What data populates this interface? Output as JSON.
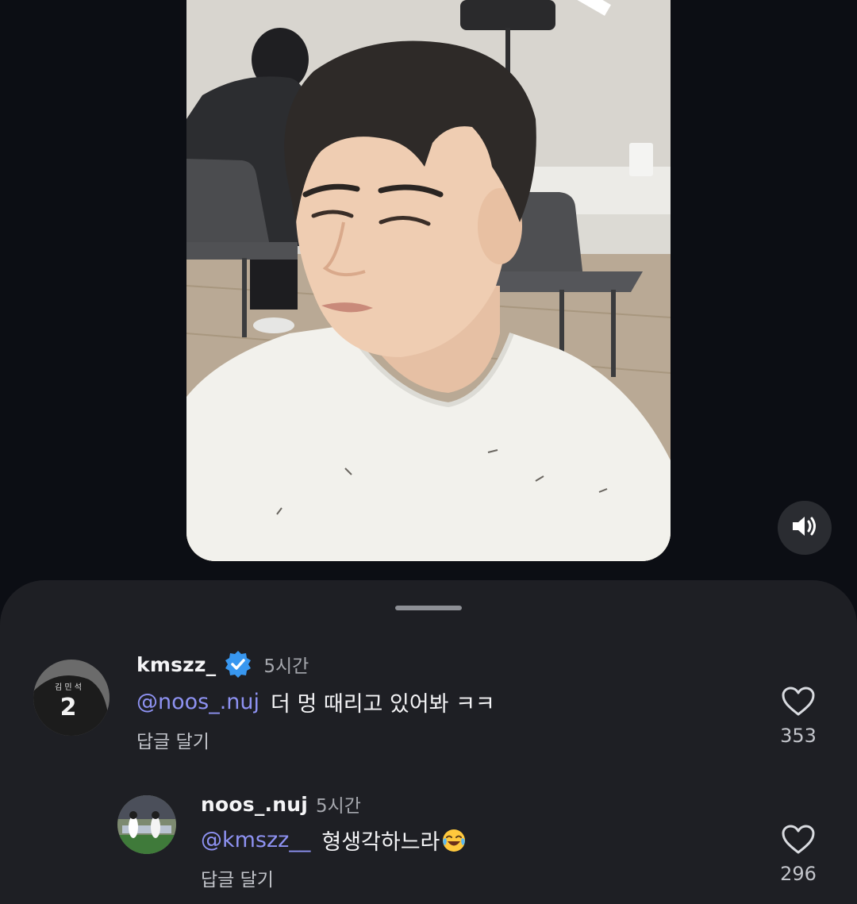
{
  "video": {
    "muted_state": "sound-on"
  },
  "icons": {
    "volume": "speaker-icon",
    "verified": "verified-badge-icon",
    "like": "heart-icon",
    "emoji": "tears-of-joy-emoji"
  },
  "colors": {
    "background": "#0c0e14",
    "sheet": "#1e1f24",
    "mention": "#8e92f2",
    "verified": "#3897f0"
  },
  "comments": [
    {
      "username": "kmszz_",
      "verified": true,
      "time": "5시간",
      "mention": "@noos_.nuj",
      "text": "더 멍 때리고 있어봐 ㅋㅋ",
      "reply_label": "답글 달기",
      "likes": "353"
    },
    {
      "username": "noos_.nuj",
      "verified": false,
      "time": "5시간",
      "mention": "@kmszz__",
      "text": "형생각하느라",
      "reply_label": "답글 달기",
      "likes": "296"
    }
  ]
}
